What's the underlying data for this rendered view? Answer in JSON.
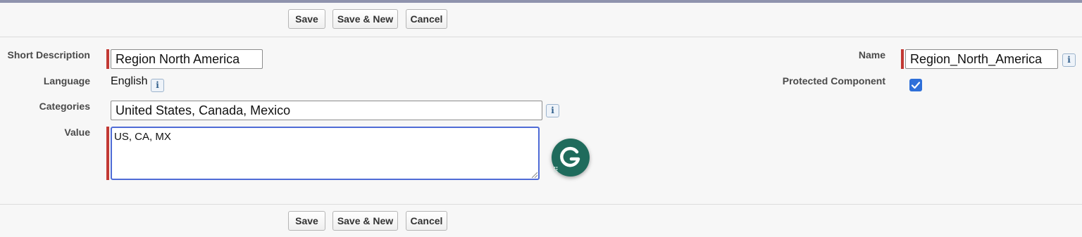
{
  "buttons": {
    "save_label": "Save",
    "save_new_label": "Save & New",
    "cancel_label": "Cancel"
  },
  "form": {
    "short_description": {
      "label": "Short Description",
      "value": "Region North America"
    },
    "language": {
      "label": "Language",
      "value": "English"
    },
    "categories": {
      "label": "Categories",
      "value": "United States, Canada, Mexico"
    },
    "value": {
      "label": "Value",
      "value": "US, CA, MX"
    },
    "name": {
      "label": "Name",
      "value": "Region_North_America"
    },
    "protected_component": {
      "label": "Protected Component",
      "checked": true
    }
  },
  "info_icon_glyph": "i",
  "icons": [
    "info-icon",
    "checkmark-icon",
    "grammarly-icon",
    "resize-handle-icon"
  ],
  "colors": {
    "required_bar": "#c23934",
    "focus_border": "#4f6bd6",
    "checkbox": "#2e6fd9",
    "grammarly": "#1f6b5c"
  }
}
